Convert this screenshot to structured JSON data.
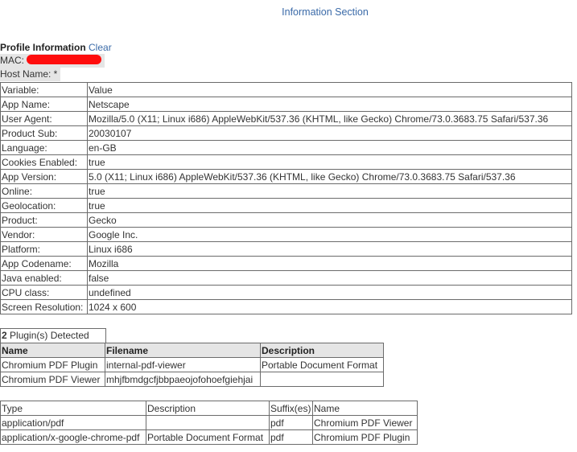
{
  "header": {
    "title": "Information Section"
  },
  "profile": {
    "title": "Profile Information",
    "clear_label": "Clear",
    "mac_label": "MAC:",
    "host_label": "Host Name: *"
  },
  "properties": {
    "rows": [
      {
        "k": "Variable:",
        "v": "Value"
      },
      {
        "k": "App Name:",
        "v": "Netscape"
      },
      {
        "k": "User Agent:",
        "v": "Mozilla/5.0 (X11; Linux i686) AppleWebKit/537.36 (KHTML, like Gecko) Chrome/73.0.3683.75 Safari/537.36"
      },
      {
        "k": "Product Sub:",
        "v": "20030107"
      },
      {
        "k": "Language:",
        "v": "en-GB"
      },
      {
        "k": "Cookies Enabled:",
        "v": "true"
      },
      {
        "k": "App Version:",
        "v": "5.0 (X11; Linux i686) AppleWebKit/537.36 (KHTML, like Gecko) Chrome/73.0.3683.75 Safari/537.36"
      },
      {
        "k": "Online:",
        "v": "true"
      },
      {
        "k": "Geolocation:",
        "v": "true"
      },
      {
        "k": "Product:",
        "v": "Gecko"
      },
      {
        "k": "Vendor:",
        "v": "Google Inc."
      },
      {
        "k": "Platform:",
        "v": "Linux i686"
      },
      {
        "k": "App Codename:",
        "v": "Mozilla"
      },
      {
        "k": "Java enabled:",
        "v": "false"
      },
      {
        "k": "CPU class:",
        "v": "undefined"
      },
      {
        "k": "Screen Resolution:",
        "v": "1024 x 600"
      }
    ]
  },
  "plugins": {
    "count": "2",
    "count_suffix": " Plugin(s) Detected",
    "headers": {
      "name": "Name",
      "filename": "Filename",
      "description": "Description"
    },
    "rows": [
      {
        "name": "Chromium PDF Plugin",
        "filename": "internal-pdf-viewer",
        "description": "Portable Document Format"
      },
      {
        "name": "Chromium PDF Viewer",
        "filename": "mhjfbmdgcfjbbpaeojofohoefgiehjai",
        "description": ""
      }
    ]
  },
  "mimes": {
    "headers": {
      "type": "Type",
      "description": "Description",
      "suffix": "Suffix(es)",
      "name": "Name"
    },
    "rows": [
      {
        "type": "application/pdf",
        "description": "",
        "suffix": "pdf",
        "name": "Chromium PDF Viewer"
      },
      {
        "type": "application/x-google-chrome-pdf",
        "description": "Portable Document Format",
        "suffix": "pdf",
        "name": "Chromium PDF Plugin"
      }
    ]
  },
  "colors": {
    "link": "#3a6aa8",
    "redaction": "#ff0d0d",
    "header_bg": "#e5e5e5"
  }
}
